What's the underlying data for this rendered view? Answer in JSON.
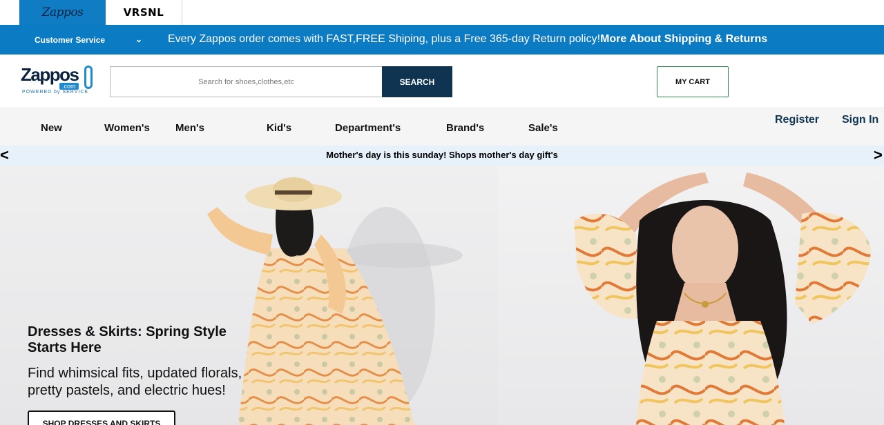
{
  "brand_tabs": {
    "zappos": "Zappos",
    "vrsnl": "VRSNL"
  },
  "promo_bar": {
    "customer_service": "Customer Service",
    "message": "Every Zappos order comes with FAST,FREE Shiping, plus a Free 365-day Return policy!",
    "link": "More About Shipping & Returns"
  },
  "header": {
    "logo": {
      "word": "Zappos",
      "com": ".com",
      "tagline": "POWERED by SERVICE"
    },
    "search_placeholder": "Search for shoes,clothes,etc",
    "search_button": "SEARCH",
    "cart_button": "MY CART"
  },
  "nav": {
    "items": [
      "New",
      "Women's",
      "Men's",
      "Kid's",
      "Department's",
      "Brand's",
      "Sale's"
    ],
    "register": "Register",
    "sign_in": "Sign In"
  },
  "notice": {
    "text": "Mother's day is this sunday! Shops mother's day gift's",
    "prev": "<",
    "next": ">"
  },
  "hero": {
    "title": "Dresses & Skirts: Spring Style Starts Here",
    "subtitle": "Find whimsical fits, updated florals, pretty pastels, and electric hues!",
    "cta": "SHOP DRESSES AND SKIRTS"
  },
  "colors": {
    "promo_blue": "#0b7bc3",
    "navy": "#0e3452",
    "cart_border": "#2f8a4c",
    "notice_bg": "#e6f1fa"
  }
}
